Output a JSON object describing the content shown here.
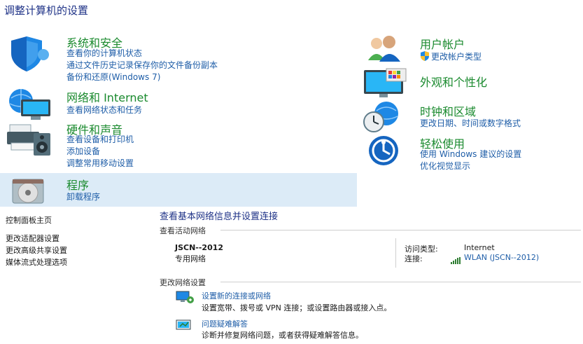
{
  "page_title": "调整计算机的设置",
  "categories": {
    "system": {
      "title": "系统和安全",
      "links": [
        "查看你的计算机状态",
        "通过文件历史记录保存你的文件备份副本",
        "备份和还原(Windows 7)"
      ]
    },
    "network": {
      "title": "网络和 Internet",
      "links": [
        "查看网络状态和任务"
      ]
    },
    "hardware": {
      "title": "硬件和声音",
      "links": [
        "查看设备和打印机",
        "添加设备",
        "调整常用移动设置"
      ]
    },
    "programs": {
      "title": "程序",
      "links": [
        "卸载程序"
      ]
    },
    "user": {
      "title": "用户帐户",
      "links": [
        "更改帐户类型"
      ]
    },
    "appearance": {
      "title": "外观和个性化",
      "links": []
    },
    "clock": {
      "title": "时钟和区域",
      "links": [
        "更改日期、时间或数字格式"
      ]
    },
    "ease": {
      "title": "轻松使用",
      "links": [
        "使用 Windows 建议的设置",
        "优化视觉显示"
      ]
    }
  },
  "network_center": {
    "header": "查看基本网络信息并设置连接",
    "sidebar": [
      "控制面板主页",
      "更改适配器设置",
      "更改高级共享设置",
      "媒体流式处理选项"
    ],
    "active_label": "查看活动网络",
    "network_name": "JSCN--2012",
    "network_type": "专用网络",
    "access_type_label": "访问类型:",
    "access_type_value": "Internet",
    "connection_label": "连接:",
    "connection_value": "WLAN (JSCN--2012)",
    "change_label": "更改网络设置",
    "tasks": [
      {
        "title": "设置新的连接或网络",
        "desc": "设置宽带、拨号或 VPN 连接；或设置路由器或接入点。"
      },
      {
        "title": "问题疑难解答",
        "desc": "诊断并修复网络问题，或者获得疑难解答信息。"
      }
    ]
  },
  "colors": {
    "title": "#1e3287",
    "category": "#1a8a2e",
    "link": "#1f5ea8",
    "hover": "#dcebf7"
  }
}
